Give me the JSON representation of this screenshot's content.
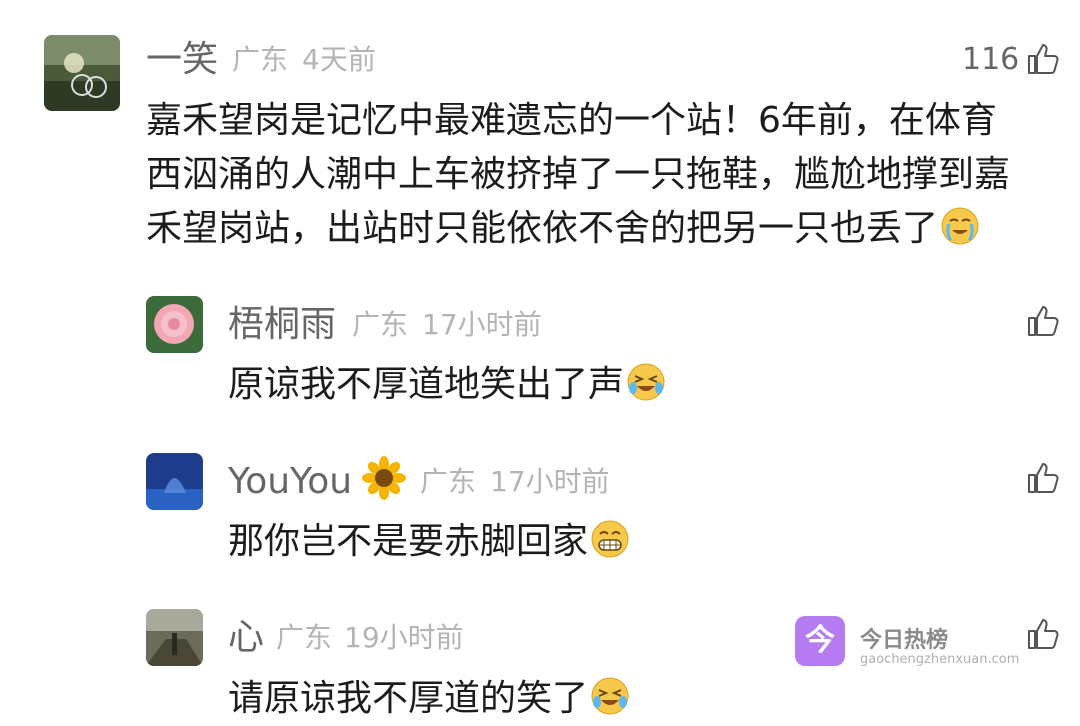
{
  "main_comment": {
    "author": "一笑",
    "location": "广东",
    "time": "4天前",
    "likes": "116",
    "lines": [
      "嘉禾望岗是记忆中最难遗忘的一个站！6年前，在体育",
      "西泅涌的人潮中上车被挤掉了一只拖鞋，尴尬地撑到嘉",
      "禾望岗站，出站时只能依依不舍的把另一只也丢了"
    ]
  },
  "replies": [
    {
      "author": "梧桐雨",
      "location": "广东",
      "time": "17小时前",
      "text": "原谅我不厚道地笑出了声"
    },
    {
      "author": "YouYou",
      "location": "广东",
      "time": "17小时前",
      "text": "那你岂不是要赤脚回家"
    },
    {
      "author": "心",
      "location": "广东",
      "time": "19小时前",
      "text": "请原谅我不厚道的笑了"
    }
  ],
  "watermark": {
    "title": "今日热榜",
    "url": "gaochengzhenxuan.com",
    "icon_char": "今",
    "color": "#b47cf0"
  }
}
